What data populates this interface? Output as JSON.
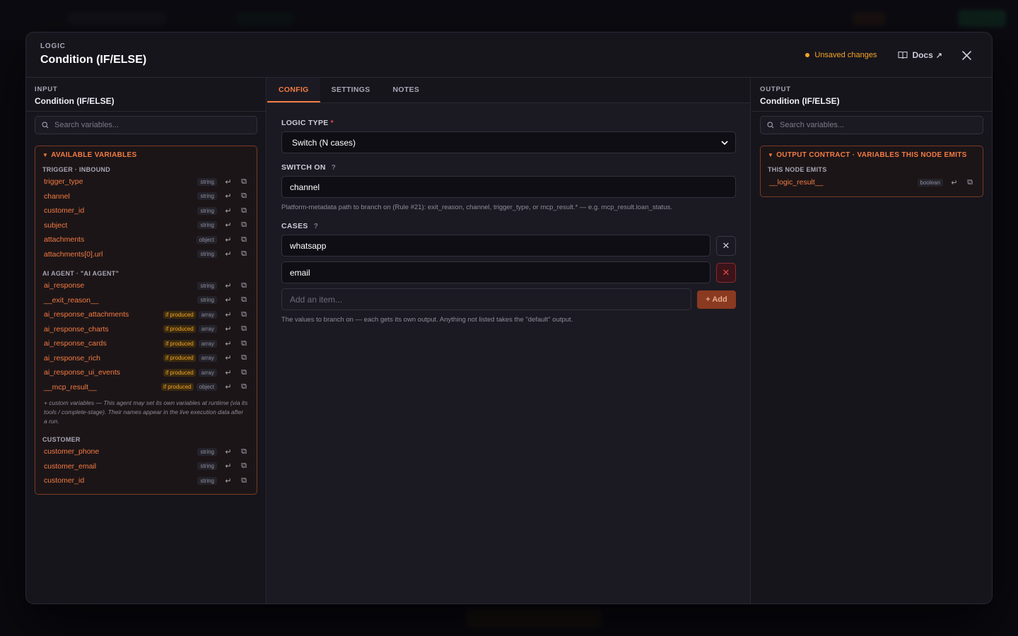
{
  "modal": {
    "eyebrow": "LOGIC",
    "title": "Condition (IF/ELSE)",
    "unsaved": "Unsaved changes",
    "docs": "Docs",
    "docs_ext": "↗"
  },
  "input_panel": {
    "eyebrow": "INPUT",
    "title": "Condition (IF/ELSE)",
    "search_placeholder": "Search variables...",
    "box_title": "AVAILABLE VARIABLES",
    "groups": [
      {
        "label": "TRIGGER · INBOUND",
        "vars": [
          {
            "name": "trigger_type",
            "type": "string"
          },
          {
            "name": "channel",
            "type": "string"
          },
          {
            "name": "customer_id",
            "type": "string"
          },
          {
            "name": "subject",
            "type": "string"
          },
          {
            "name": "attachments",
            "type": "object"
          },
          {
            "name": "attachments[0].url",
            "type": "string"
          }
        ]
      },
      {
        "label": "AI AGENT · \"AI AGENT\"",
        "vars": [
          {
            "name": "ai_response",
            "type": "string"
          },
          {
            "name": "__exit_reason__",
            "type": "string"
          },
          {
            "name": "ai_response_attachments",
            "type": "array",
            "badge": "if produced"
          },
          {
            "name": "ai_response_charts",
            "type": "array",
            "badge": "if produced"
          },
          {
            "name": "ai_response_cards",
            "type": "array",
            "badge": "if produced"
          },
          {
            "name": "ai_response_rich",
            "type": "array",
            "badge": "if produced"
          },
          {
            "name": "ai_response_ui_events",
            "type": "array",
            "badge": "if produced"
          },
          {
            "name": "__mcp_result__",
            "type": "object",
            "badge": "if produced"
          }
        ],
        "note": "+ custom variables — This agent may set its own variables at runtime (via its tools / complete-stage). Their names appear in the live execution data after a run."
      },
      {
        "label": "CUSTOMER",
        "vars": [
          {
            "name": "customer_phone",
            "type": "string"
          },
          {
            "name": "customer_email",
            "type": "string"
          },
          {
            "name": "customer_id",
            "type": "string"
          }
        ]
      }
    ]
  },
  "tabs": [
    "CONFIG",
    "SETTINGS",
    "NOTES"
  ],
  "config": {
    "logic_type_label": "LOGIC TYPE",
    "logic_type_value": "Switch (N cases)",
    "switch_on_label": "SWITCH ON",
    "switch_on_help": "?",
    "switch_on_value": "channel",
    "switch_on_hint": "Platform-metadata path to branch on (Rule #21): exit_reason, channel, trigger_type, or mcp_result.* — e.g. mcp_result.loan_status.",
    "cases_label": "CASES",
    "cases_help": "?",
    "cases": [
      "whatsapp",
      "email"
    ],
    "add_placeholder": "Add an item...",
    "add_button": "+ Add",
    "cases_hint": "The values to branch on — each gets its own output. Anything not listed takes the \"default\" output."
  },
  "output_panel": {
    "eyebrow": "OUTPUT",
    "title": "Condition (IF/ELSE)",
    "search_placeholder": "Search variables...",
    "box_title": "OUTPUT CONTRACT · VARIABLES THIS NODE EMITS",
    "group_label": "THIS NODE EMITS",
    "vars": [
      {
        "name": "__logic_result__",
        "type": "boolean"
      }
    ]
  },
  "colors": {
    "accent": "#f37c43",
    "warning": "#f5a524",
    "danger": "#e5484d"
  }
}
